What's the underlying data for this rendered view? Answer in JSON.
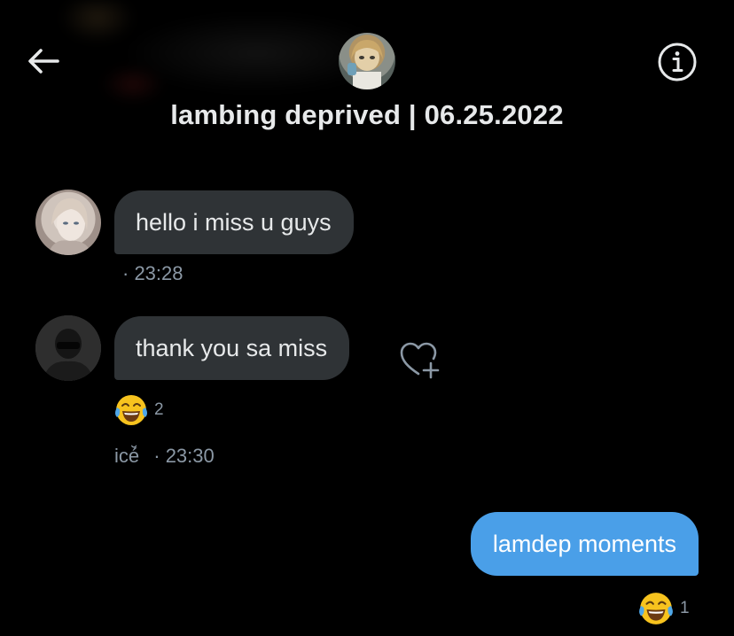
{
  "header": {
    "title": "lambing deprived | 06.25.2022",
    "back_icon": "arrow-left-icon",
    "info_icon": "info-icon"
  },
  "messages": [
    {
      "text": "hello i miss u guys",
      "time": "· 23:28"
    },
    {
      "text": "thank you sa miss",
      "sender": "icé̆",
      "time": "· 23:30",
      "reaction": {
        "emoji": "😂",
        "count": "2"
      }
    },
    {
      "text": "lamdep moments",
      "reaction": {
        "emoji": "😂",
        "count": "1"
      }
    }
  ],
  "colors": {
    "background": "#000000",
    "incoming_bubble": "#2f3336",
    "outgoing_bubble": "#4a9fe8",
    "meta_text": "#8b98a5"
  }
}
